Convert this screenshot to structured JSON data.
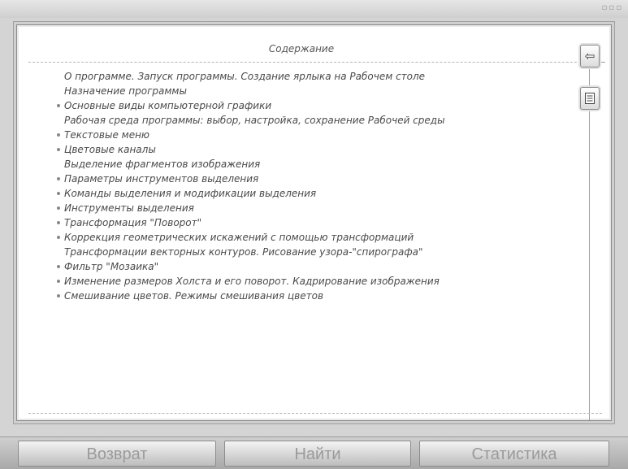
{
  "content": {
    "title": "Содержание",
    "items": [
      {
        "text": "О программе. Запуск программы. Создание ярлыка на Рабочем столе",
        "bullet": false
      },
      {
        "text": "Назначение программы",
        "bullet": false
      },
      {
        "text": "Основные виды компьютерной графики",
        "bullet": true
      },
      {
        "text": "Рабочая среда программы: выбор, настройка, сохранение Рабочей среды",
        "bullet": false
      },
      {
        "text": "Текстовые меню",
        "bullet": true
      },
      {
        "text": "Цветовые каналы",
        "bullet": true
      },
      {
        "text": "Выделение фрагментов изображения",
        "bullet": false
      },
      {
        "text": "Параметры инструментов выделения",
        "bullet": true
      },
      {
        "text": "Команды выделения и модификации выделения",
        "bullet": true
      },
      {
        "text": "Инструменты выделения",
        "bullet": true
      },
      {
        "text": "Трансформация \"Поворот\"",
        "bullet": true
      },
      {
        "text": "Коррекция геометрических искажений с помощью трансформаций",
        "bullet": true
      },
      {
        "text": "Трансформации векторных контуров. Рисование узора-\"спирографа\"",
        "bullet": false
      },
      {
        "text": "Фильтр \"Мозаика\"",
        "bullet": true
      },
      {
        "text": "Изменение размеров Холста и его поворот. Кадрирование изображения",
        "bullet": true
      },
      {
        "text": "Смешивание цветов. Режимы смешивания цветов",
        "bullet": true
      }
    ]
  },
  "side_buttons": {
    "back_icon": "arrow-left-icon",
    "list_icon": "document-list-icon"
  },
  "nav": {
    "back_label": "Возврат",
    "find_label": "Найти",
    "stats_label": "Статистика"
  }
}
